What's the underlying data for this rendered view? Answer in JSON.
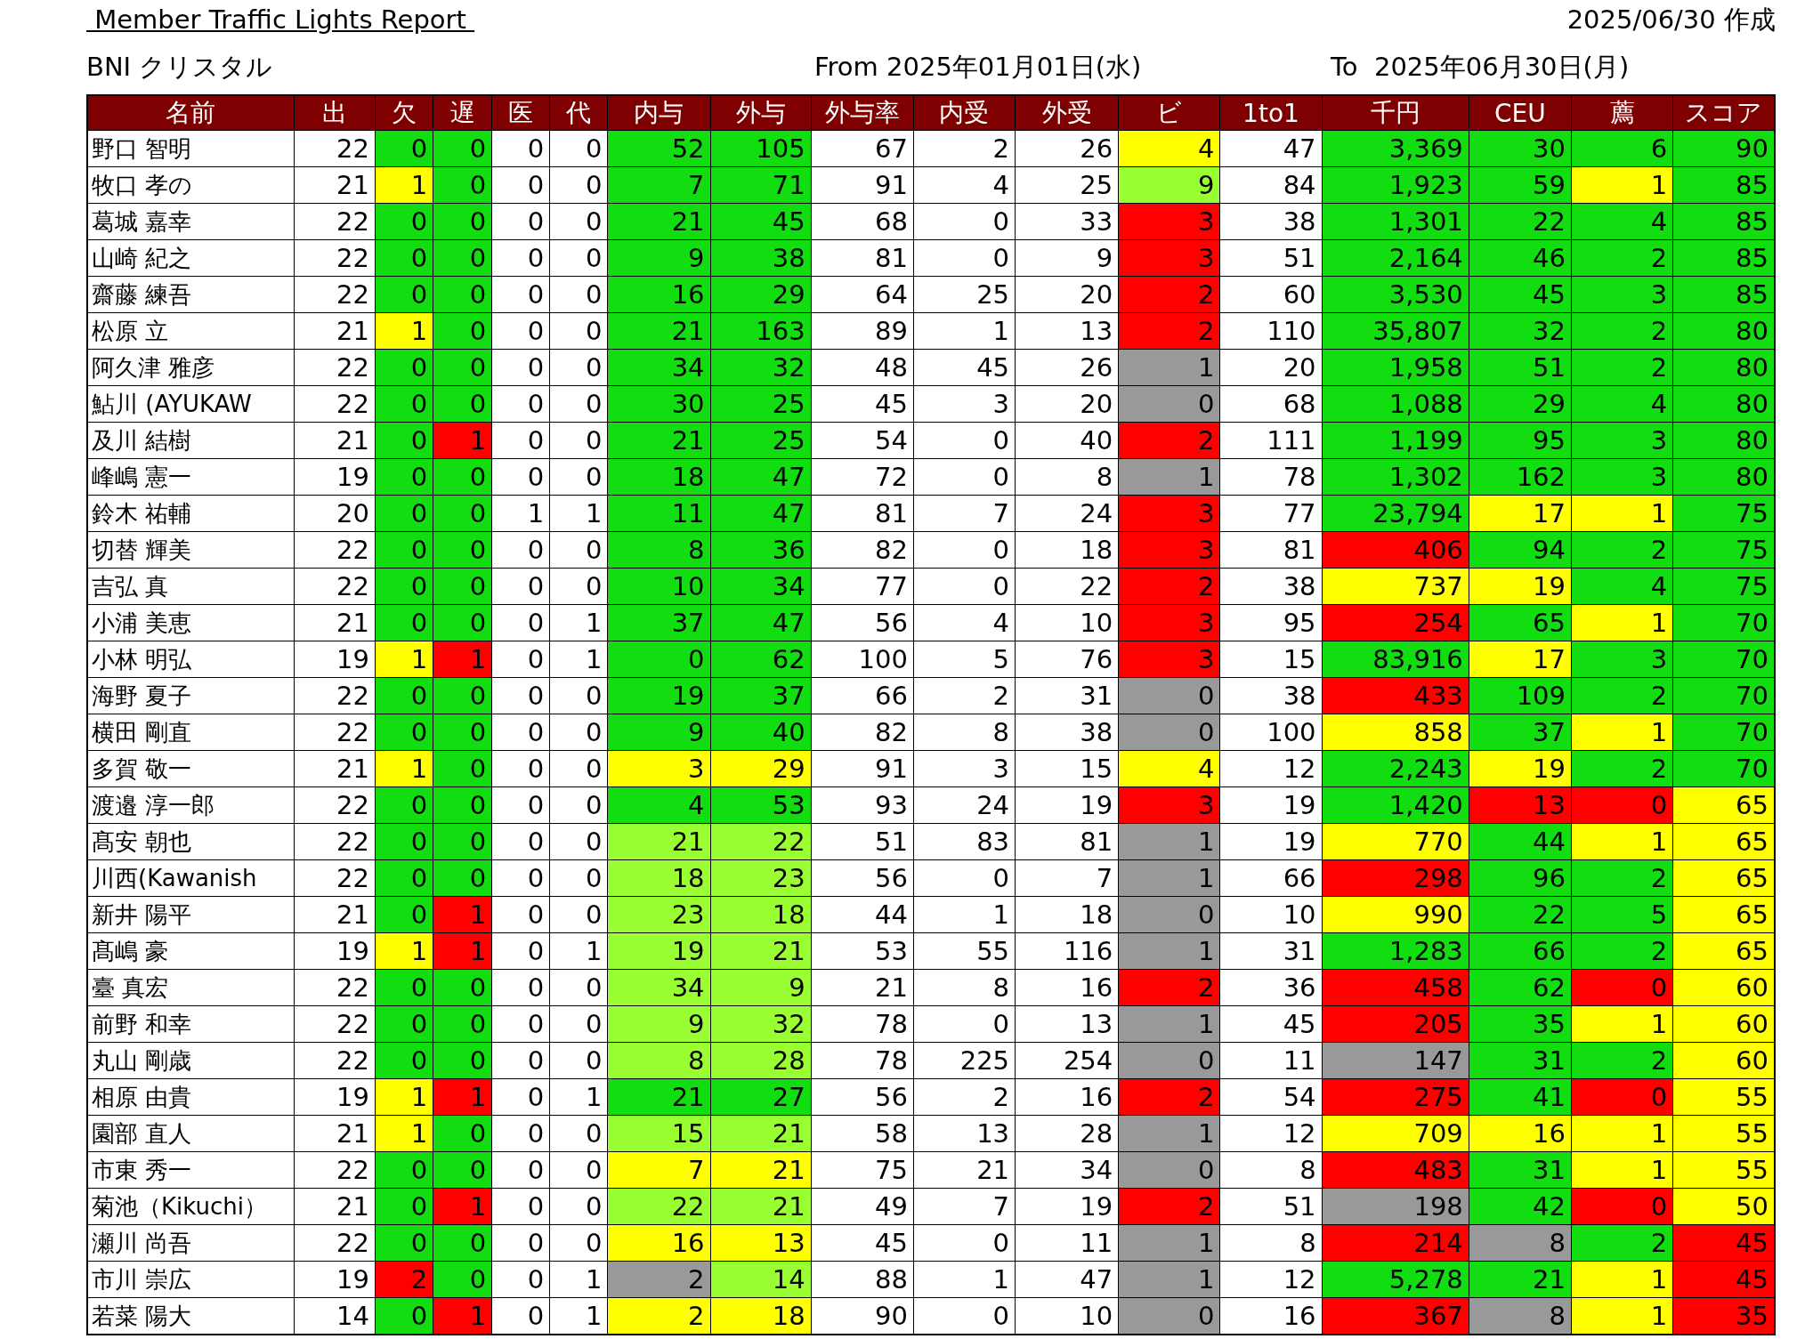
{
  "header": {
    "title": " Member Traffic Lights Report ",
    "created": "2025/06/30 作成",
    "group": "BNI クリスタル",
    "from": "From 2025年01月01日(水)",
    "to": "To  2025年06月30日(月)"
  },
  "table": {
    "columns": [
      "名前",
      "出",
      "欠",
      "遅",
      "医",
      "代",
      "内与",
      "外与",
      "外与率",
      "内受",
      "外受",
      "ビ",
      "1to1",
      "千円",
      "CEU",
      "薦",
      "スコア"
    ],
    "rows": [
      {
        "cells": [
          {
            "text": "野口 智明"
          },
          {
            "text": "22"
          },
          {
            "text": "0",
            "color": "#11dd11"
          },
          {
            "text": "0",
            "color": "#11dd11"
          },
          {
            "text": "0"
          },
          {
            "text": "0"
          },
          {
            "text": "52",
            "color": "#11dd11"
          },
          {
            "text": "105",
            "color": "#11dd11"
          },
          {
            "text": "67"
          },
          {
            "text": "2"
          },
          {
            "text": "26"
          },
          {
            "text": "4",
            "color": "#ffff00"
          },
          {
            "text": "47"
          },
          {
            "text": "3,369",
            "color": "#11dd11"
          },
          {
            "text": "30",
            "color": "#11dd11"
          },
          {
            "text": "6",
            "color": "#11dd11"
          },
          {
            "text": "90",
            "color": "#11dd11"
          }
        ]
      },
      {
        "cells": [
          {
            "text": "牧口 孝の"
          },
          {
            "text": "21"
          },
          {
            "text": "1",
            "color": "#ffff00"
          },
          {
            "text": "0",
            "color": "#11dd11"
          },
          {
            "text": "0"
          },
          {
            "text": "0"
          },
          {
            "text": "7",
            "color": "#11dd11"
          },
          {
            "text": "71",
            "color": "#11dd11"
          },
          {
            "text": "91"
          },
          {
            "text": "4"
          },
          {
            "text": "25"
          },
          {
            "text": "9",
            "color": "#99ff33"
          },
          {
            "text": "84"
          },
          {
            "text": "1,923",
            "color": "#11dd11"
          },
          {
            "text": "59",
            "color": "#11dd11"
          },
          {
            "text": "1",
            "color": "#ffff00"
          },
          {
            "text": "85",
            "color": "#11dd11"
          }
        ]
      },
      {
        "cells": [
          {
            "text": "葛城 嘉幸"
          },
          {
            "text": "22"
          },
          {
            "text": "0",
            "color": "#11dd11"
          },
          {
            "text": "0",
            "color": "#11dd11"
          },
          {
            "text": "0"
          },
          {
            "text": "0"
          },
          {
            "text": "21",
            "color": "#11dd11"
          },
          {
            "text": "45",
            "color": "#11dd11"
          },
          {
            "text": "68"
          },
          {
            "text": "0"
          },
          {
            "text": "33"
          },
          {
            "text": "3",
            "color": "#ff0000"
          },
          {
            "text": "38"
          },
          {
            "text": "1,301",
            "color": "#11dd11"
          },
          {
            "text": "22",
            "color": "#11dd11"
          },
          {
            "text": "4",
            "color": "#11dd11"
          },
          {
            "text": "85",
            "color": "#11dd11"
          }
        ]
      },
      {
        "cells": [
          {
            "text": "山崎 紀之"
          },
          {
            "text": "22"
          },
          {
            "text": "0",
            "color": "#11dd11"
          },
          {
            "text": "0",
            "color": "#11dd11"
          },
          {
            "text": "0"
          },
          {
            "text": "0"
          },
          {
            "text": "9",
            "color": "#11dd11"
          },
          {
            "text": "38",
            "color": "#11dd11"
          },
          {
            "text": "81"
          },
          {
            "text": "0"
          },
          {
            "text": "9"
          },
          {
            "text": "3",
            "color": "#ff0000"
          },
          {
            "text": "51"
          },
          {
            "text": "2,164",
            "color": "#11dd11"
          },
          {
            "text": "46",
            "color": "#11dd11"
          },
          {
            "text": "2",
            "color": "#11dd11"
          },
          {
            "text": "85",
            "color": "#11dd11"
          }
        ]
      },
      {
        "cells": [
          {
            "text": "齋藤 練吾"
          },
          {
            "text": "22"
          },
          {
            "text": "0",
            "color": "#11dd11"
          },
          {
            "text": "0",
            "color": "#11dd11"
          },
          {
            "text": "0"
          },
          {
            "text": "0"
          },
          {
            "text": "16",
            "color": "#11dd11"
          },
          {
            "text": "29",
            "color": "#11dd11"
          },
          {
            "text": "64"
          },
          {
            "text": "25"
          },
          {
            "text": "20"
          },
          {
            "text": "2",
            "color": "#ff0000"
          },
          {
            "text": "60"
          },
          {
            "text": "3,530",
            "color": "#11dd11"
          },
          {
            "text": "45",
            "color": "#11dd11"
          },
          {
            "text": "3",
            "color": "#11dd11"
          },
          {
            "text": "85",
            "color": "#11dd11"
          }
        ]
      },
      {
        "cells": [
          {
            "text": "松原 立"
          },
          {
            "text": "21"
          },
          {
            "text": "1",
            "color": "#ffff00"
          },
          {
            "text": "0",
            "color": "#11dd11"
          },
          {
            "text": "0"
          },
          {
            "text": "0"
          },
          {
            "text": "21",
            "color": "#11dd11"
          },
          {
            "text": "163",
            "color": "#11dd11"
          },
          {
            "text": "89"
          },
          {
            "text": "1"
          },
          {
            "text": "13"
          },
          {
            "text": "2",
            "color": "#ff0000"
          },
          {
            "text": "110"
          },
          {
            "text": "35,807",
            "color": "#11dd11"
          },
          {
            "text": "32",
            "color": "#11dd11"
          },
          {
            "text": "2",
            "color": "#11dd11"
          },
          {
            "text": "80",
            "color": "#11dd11"
          }
        ]
      },
      {
        "cells": [
          {
            "text": "阿久津 雅彦"
          },
          {
            "text": "22"
          },
          {
            "text": "0",
            "color": "#11dd11"
          },
          {
            "text": "0",
            "color": "#11dd11"
          },
          {
            "text": "0"
          },
          {
            "text": "0"
          },
          {
            "text": "34",
            "color": "#11dd11"
          },
          {
            "text": "32",
            "color": "#11dd11"
          },
          {
            "text": "48"
          },
          {
            "text": "45"
          },
          {
            "text": "26"
          },
          {
            "text": "1",
            "color": "#999999"
          },
          {
            "text": "20"
          },
          {
            "text": "1,958",
            "color": "#11dd11"
          },
          {
            "text": "51",
            "color": "#11dd11"
          },
          {
            "text": "2",
            "color": "#11dd11"
          },
          {
            "text": "80",
            "color": "#11dd11"
          }
        ]
      },
      {
        "cells": [
          {
            "text": "鮎川 (AYUKAW"
          },
          {
            "text": "22"
          },
          {
            "text": "0",
            "color": "#11dd11"
          },
          {
            "text": "0",
            "color": "#11dd11"
          },
          {
            "text": "0"
          },
          {
            "text": "0"
          },
          {
            "text": "30",
            "color": "#11dd11"
          },
          {
            "text": "25",
            "color": "#11dd11"
          },
          {
            "text": "45"
          },
          {
            "text": "3"
          },
          {
            "text": "20"
          },
          {
            "text": "0",
            "color": "#999999"
          },
          {
            "text": "68"
          },
          {
            "text": "1,088",
            "color": "#11dd11"
          },
          {
            "text": "29",
            "color": "#11dd11"
          },
          {
            "text": "4",
            "color": "#11dd11"
          },
          {
            "text": "80",
            "color": "#11dd11"
          }
        ]
      },
      {
        "cells": [
          {
            "text": "及川 結樹"
          },
          {
            "text": "21"
          },
          {
            "text": "0",
            "color": "#11dd11"
          },
          {
            "text": "1",
            "color": "#ff0000"
          },
          {
            "text": "0"
          },
          {
            "text": "0"
          },
          {
            "text": "21",
            "color": "#11dd11"
          },
          {
            "text": "25",
            "color": "#11dd11"
          },
          {
            "text": "54"
          },
          {
            "text": "0"
          },
          {
            "text": "40"
          },
          {
            "text": "2",
            "color": "#ff0000"
          },
          {
            "text": "111"
          },
          {
            "text": "1,199",
            "color": "#11dd11"
          },
          {
            "text": "95",
            "color": "#11dd11"
          },
          {
            "text": "3",
            "color": "#11dd11"
          },
          {
            "text": "80",
            "color": "#11dd11"
          }
        ]
      },
      {
        "cells": [
          {
            "text": "峰嶋 憲一"
          },
          {
            "text": "19"
          },
          {
            "text": "0",
            "color": "#11dd11"
          },
          {
            "text": "0",
            "color": "#11dd11"
          },
          {
            "text": "0"
          },
          {
            "text": "0"
          },
          {
            "text": "18",
            "color": "#11dd11"
          },
          {
            "text": "47",
            "color": "#11dd11"
          },
          {
            "text": "72"
          },
          {
            "text": "0"
          },
          {
            "text": "8"
          },
          {
            "text": "1",
            "color": "#999999"
          },
          {
            "text": "78"
          },
          {
            "text": "1,302",
            "color": "#11dd11"
          },
          {
            "text": "162",
            "color": "#11dd11"
          },
          {
            "text": "3",
            "color": "#11dd11"
          },
          {
            "text": "80",
            "color": "#11dd11"
          }
        ]
      },
      {
        "cells": [
          {
            "text": "鈴木 祐輔"
          },
          {
            "text": "20"
          },
          {
            "text": "0",
            "color": "#11dd11"
          },
          {
            "text": "0",
            "color": "#11dd11"
          },
          {
            "text": "1"
          },
          {
            "text": "1"
          },
          {
            "text": "11",
            "color": "#11dd11"
          },
          {
            "text": "47",
            "color": "#11dd11"
          },
          {
            "text": "81"
          },
          {
            "text": "7"
          },
          {
            "text": "24"
          },
          {
            "text": "3",
            "color": "#ff0000"
          },
          {
            "text": "77"
          },
          {
            "text": "23,794",
            "color": "#11dd11"
          },
          {
            "text": "17",
            "color": "#ffff00"
          },
          {
            "text": "1",
            "color": "#ffff00"
          },
          {
            "text": "75",
            "color": "#11dd11"
          }
        ]
      },
      {
        "cells": [
          {
            "text": "切替 輝美"
          },
          {
            "text": "22"
          },
          {
            "text": "0",
            "color": "#11dd11"
          },
          {
            "text": "0",
            "color": "#11dd11"
          },
          {
            "text": "0"
          },
          {
            "text": "0"
          },
          {
            "text": "8",
            "color": "#11dd11"
          },
          {
            "text": "36",
            "color": "#11dd11"
          },
          {
            "text": "82"
          },
          {
            "text": "0"
          },
          {
            "text": "18"
          },
          {
            "text": "3",
            "color": "#ff0000"
          },
          {
            "text": "81"
          },
          {
            "text": "406",
            "color": "#ff0000"
          },
          {
            "text": "94",
            "color": "#11dd11"
          },
          {
            "text": "2",
            "color": "#11dd11"
          },
          {
            "text": "75",
            "color": "#11dd11"
          }
        ]
      },
      {
        "cells": [
          {
            "text": "吉弘 真"
          },
          {
            "text": "22"
          },
          {
            "text": "0",
            "color": "#11dd11"
          },
          {
            "text": "0",
            "color": "#11dd11"
          },
          {
            "text": "0"
          },
          {
            "text": "0"
          },
          {
            "text": "10",
            "color": "#11dd11"
          },
          {
            "text": "34",
            "color": "#11dd11"
          },
          {
            "text": "77"
          },
          {
            "text": "0"
          },
          {
            "text": "22"
          },
          {
            "text": "2",
            "color": "#ff0000"
          },
          {
            "text": "38"
          },
          {
            "text": "737",
            "color": "#ffff00"
          },
          {
            "text": "19",
            "color": "#ffff00"
          },
          {
            "text": "4",
            "color": "#11dd11"
          },
          {
            "text": "75",
            "color": "#11dd11"
          }
        ]
      },
      {
        "cells": [
          {
            "text": "小浦 美恵"
          },
          {
            "text": "21"
          },
          {
            "text": "0",
            "color": "#11dd11"
          },
          {
            "text": "0",
            "color": "#11dd11"
          },
          {
            "text": "0"
          },
          {
            "text": "1"
          },
          {
            "text": "37",
            "color": "#11dd11"
          },
          {
            "text": "47",
            "color": "#11dd11"
          },
          {
            "text": "56"
          },
          {
            "text": "4"
          },
          {
            "text": "10"
          },
          {
            "text": "3",
            "color": "#ff0000"
          },
          {
            "text": "95"
          },
          {
            "text": "254",
            "color": "#ff0000"
          },
          {
            "text": "65",
            "color": "#11dd11"
          },
          {
            "text": "1",
            "color": "#ffff00"
          },
          {
            "text": "70",
            "color": "#11dd11"
          }
        ]
      },
      {
        "cells": [
          {
            "text": "小林 明弘"
          },
          {
            "text": "19"
          },
          {
            "text": "1",
            "color": "#ffff00"
          },
          {
            "text": "1",
            "color": "#ff0000"
          },
          {
            "text": "0"
          },
          {
            "text": "1"
          },
          {
            "text": "0",
            "color": "#11dd11"
          },
          {
            "text": "62",
            "color": "#11dd11"
          },
          {
            "text": "100"
          },
          {
            "text": "5"
          },
          {
            "text": "76"
          },
          {
            "text": "3",
            "color": "#ff0000"
          },
          {
            "text": "15"
          },
          {
            "text": "83,916",
            "color": "#11dd11"
          },
          {
            "text": "17",
            "color": "#ffff00"
          },
          {
            "text": "3",
            "color": "#11dd11"
          },
          {
            "text": "70",
            "color": "#11dd11"
          }
        ]
      },
      {
        "cells": [
          {
            "text": "海野 夏子"
          },
          {
            "text": "22"
          },
          {
            "text": "0",
            "color": "#11dd11"
          },
          {
            "text": "0",
            "color": "#11dd11"
          },
          {
            "text": "0"
          },
          {
            "text": "0"
          },
          {
            "text": "19",
            "color": "#11dd11"
          },
          {
            "text": "37",
            "color": "#11dd11"
          },
          {
            "text": "66"
          },
          {
            "text": "2"
          },
          {
            "text": "31"
          },
          {
            "text": "0",
            "color": "#999999"
          },
          {
            "text": "38"
          },
          {
            "text": "433",
            "color": "#ff0000"
          },
          {
            "text": "109",
            "color": "#11dd11"
          },
          {
            "text": "2",
            "color": "#11dd11"
          },
          {
            "text": "70",
            "color": "#11dd11"
          }
        ]
      },
      {
        "cells": [
          {
            "text": "横田 剛直"
          },
          {
            "text": "22"
          },
          {
            "text": "0",
            "color": "#11dd11"
          },
          {
            "text": "0",
            "color": "#11dd11"
          },
          {
            "text": "0"
          },
          {
            "text": "0"
          },
          {
            "text": "9",
            "color": "#11dd11"
          },
          {
            "text": "40",
            "color": "#11dd11"
          },
          {
            "text": "82"
          },
          {
            "text": "8"
          },
          {
            "text": "38"
          },
          {
            "text": "0",
            "color": "#999999"
          },
          {
            "text": "100"
          },
          {
            "text": "858",
            "color": "#ffff00"
          },
          {
            "text": "37",
            "color": "#11dd11"
          },
          {
            "text": "1",
            "color": "#ffff00"
          },
          {
            "text": "70",
            "color": "#11dd11"
          }
        ]
      },
      {
        "cells": [
          {
            "text": "多賀 敬一"
          },
          {
            "text": "21"
          },
          {
            "text": "1",
            "color": "#ffff00"
          },
          {
            "text": "0",
            "color": "#11dd11"
          },
          {
            "text": "0"
          },
          {
            "text": "0"
          },
          {
            "text": "3",
            "color": "#ffff00"
          },
          {
            "text": "29",
            "color": "#ffff00"
          },
          {
            "text": "91"
          },
          {
            "text": "3"
          },
          {
            "text": "15"
          },
          {
            "text": "4",
            "color": "#ffff00"
          },
          {
            "text": "12"
          },
          {
            "text": "2,243",
            "color": "#11dd11"
          },
          {
            "text": "19",
            "color": "#ffff00"
          },
          {
            "text": "2",
            "color": "#11dd11"
          },
          {
            "text": "70",
            "color": "#11dd11"
          }
        ]
      },
      {
        "cells": [
          {
            "text": "渡邉 淳一郎"
          },
          {
            "text": "22"
          },
          {
            "text": "0",
            "color": "#11dd11"
          },
          {
            "text": "0",
            "color": "#11dd11"
          },
          {
            "text": "0"
          },
          {
            "text": "0"
          },
          {
            "text": "4",
            "color": "#11dd11"
          },
          {
            "text": "53",
            "color": "#11dd11"
          },
          {
            "text": "93"
          },
          {
            "text": "24"
          },
          {
            "text": "19"
          },
          {
            "text": "3",
            "color": "#ff0000"
          },
          {
            "text": "19"
          },
          {
            "text": "1,420",
            "color": "#11dd11"
          },
          {
            "text": "13",
            "color": "#ff0000"
          },
          {
            "text": "0",
            "color": "#ff0000"
          },
          {
            "text": "65",
            "color": "#ffff00"
          }
        ]
      },
      {
        "cells": [
          {
            "text": "髙安 朝也"
          },
          {
            "text": "22"
          },
          {
            "text": "0",
            "color": "#11dd11"
          },
          {
            "text": "0",
            "color": "#11dd11"
          },
          {
            "text": "0"
          },
          {
            "text": "0"
          },
          {
            "text": "21",
            "color": "#99ff33"
          },
          {
            "text": "22",
            "color": "#99ff33"
          },
          {
            "text": "51"
          },
          {
            "text": "83"
          },
          {
            "text": "81"
          },
          {
            "text": "1",
            "color": "#999999"
          },
          {
            "text": "19"
          },
          {
            "text": "770",
            "color": "#ffff00"
          },
          {
            "text": "44",
            "color": "#11dd11"
          },
          {
            "text": "1",
            "color": "#ffff00"
          },
          {
            "text": "65",
            "color": "#ffff00"
          }
        ]
      },
      {
        "cells": [
          {
            "text": "川西(Kawanish"
          },
          {
            "text": "22"
          },
          {
            "text": "0",
            "color": "#11dd11"
          },
          {
            "text": "0",
            "color": "#11dd11"
          },
          {
            "text": "0"
          },
          {
            "text": "0"
          },
          {
            "text": "18",
            "color": "#99ff33"
          },
          {
            "text": "23",
            "color": "#99ff33"
          },
          {
            "text": "56"
          },
          {
            "text": "0"
          },
          {
            "text": "7"
          },
          {
            "text": "1",
            "color": "#999999"
          },
          {
            "text": "66"
          },
          {
            "text": "298",
            "color": "#ff0000"
          },
          {
            "text": "96",
            "color": "#11dd11"
          },
          {
            "text": "2",
            "color": "#11dd11"
          },
          {
            "text": "65",
            "color": "#ffff00"
          }
        ]
      },
      {
        "cells": [
          {
            "text": "新井 陽平"
          },
          {
            "text": "21"
          },
          {
            "text": "0",
            "color": "#11dd11"
          },
          {
            "text": "1",
            "color": "#ff0000"
          },
          {
            "text": "0"
          },
          {
            "text": "0"
          },
          {
            "text": "23",
            "color": "#99ff33"
          },
          {
            "text": "18",
            "color": "#99ff33"
          },
          {
            "text": "44"
          },
          {
            "text": "1"
          },
          {
            "text": "18"
          },
          {
            "text": "0",
            "color": "#999999"
          },
          {
            "text": "10"
          },
          {
            "text": "990",
            "color": "#ffff00"
          },
          {
            "text": "22",
            "color": "#11dd11"
          },
          {
            "text": "5",
            "color": "#11dd11"
          },
          {
            "text": "65",
            "color": "#ffff00"
          }
        ]
      },
      {
        "cells": [
          {
            "text": "髙嶋 豪"
          },
          {
            "text": "19"
          },
          {
            "text": "1",
            "color": "#ffff00"
          },
          {
            "text": "1",
            "color": "#ff0000"
          },
          {
            "text": "0"
          },
          {
            "text": "1"
          },
          {
            "text": "19",
            "color": "#99ff33"
          },
          {
            "text": "21",
            "color": "#99ff33"
          },
          {
            "text": "53"
          },
          {
            "text": "55"
          },
          {
            "text": "116"
          },
          {
            "text": "1",
            "color": "#999999"
          },
          {
            "text": "31"
          },
          {
            "text": "1,283",
            "color": "#11dd11"
          },
          {
            "text": "66",
            "color": "#11dd11"
          },
          {
            "text": "2",
            "color": "#11dd11"
          },
          {
            "text": "65",
            "color": "#ffff00"
          }
        ]
      },
      {
        "cells": [
          {
            "text": "臺 真宏"
          },
          {
            "text": "22"
          },
          {
            "text": "0",
            "color": "#11dd11"
          },
          {
            "text": "0",
            "color": "#11dd11"
          },
          {
            "text": "0"
          },
          {
            "text": "0"
          },
          {
            "text": "34",
            "color": "#99ff33"
          },
          {
            "text": "9",
            "color": "#99ff33"
          },
          {
            "text": "21"
          },
          {
            "text": "8"
          },
          {
            "text": "16"
          },
          {
            "text": "2",
            "color": "#ff0000"
          },
          {
            "text": "36"
          },
          {
            "text": "458",
            "color": "#ff0000"
          },
          {
            "text": "62",
            "color": "#11dd11"
          },
          {
            "text": "0",
            "color": "#ff0000"
          },
          {
            "text": "60",
            "color": "#ffff00"
          }
        ]
      },
      {
        "cells": [
          {
            "text": "前野 和幸"
          },
          {
            "text": "22"
          },
          {
            "text": "0",
            "color": "#11dd11"
          },
          {
            "text": "0",
            "color": "#11dd11"
          },
          {
            "text": "0"
          },
          {
            "text": "0"
          },
          {
            "text": "9",
            "color": "#99ff33"
          },
          {
            "text": "32",
            "color": "#99ff33"
          },
          {
            "text": "78"
          },
          {
            "text": "0"
          },
          {
            "text": "13"
          },
          {
            "text": "1",
            "color": "#999999"
          },
          {
            "text": "45"
          },
          {
            "text": "205",
            "color": "#ff0000"
          },
          {
            "text": "35",
            "color": "#11dd11"
          },
          {
            "text": "1",
            "color": "#ffff00"
          },
          {
            "text": "60",
            "color": "#ffff00"
          }
        ]
      },
      {
        "cells": [
          {
            "text": "丸山 剛歳"
          },
          {
            "text": "22"
          },
          {
            "text": "0",
            "color": "#11dd11"
          },
          {
            "text": "0",
            "color": "#11dd11"
          },
          {
            "text": "0"
          },
          {
            "text": "0"
          },
          {
            "text": "8",
            "color": "#99ff33"
          },
          {
            "text": "28",
            "color": "#99ff33"
          },
          {
            "text": "78"
          },
          {
            "text": "225"
          },
          {
            "text": "254"
          },
          {
            "text": "0",
            "color": "#999999"
          },
          {
            "text": "11"
          },
          {
            "text": "147",
            "color": "#999999"
          },
          {
            "text": "31",
            "color": "#11dd11"
          },
          {
            "text": "2",
            "color": "#11dd11"
          },
          {
            "text": "60",
            "color": "#ffff00"
          }
        ]
      },
      {
        "cells": [
          {
            "text": "相原 由貴"
          },
          {
            "text": "19"
          },
          {
            "text": "1",
            "color": "#ffff00"
          },
          {
            "text": "1",
            "color": "#ff0000"
          },
          {
            "text": "0"
          },
          {
            "text": "1"
          },
          {
            "text": "21",
            "color": "#11dd11"
          },
          {
            "text": "27",
            "color": "#11dd11"
          },
          {
            "text": "56"
          },
          {
            "text": "2"
          },
          {
            "text": "16"
          },
          {
            "text": "2",
            "color": "#ff0000"
          },
          {
            "text": "54"
          },
          {
            "text": "275",
            "color": "#ff0000"
          },
          {
            "text": "41",
            "color": "#11dd11"
          },
          {
            "text": "0",
            "color": "#ff0000"
          },
          {
            "text": "55",
            "color": "#ffff00"
          }
        ]
      },
      {
        "cells": [
          {
            "text": "園部 直人"
          },
          {
            "text": "21"
          },
          {
            "text": "1",
            "color": "#ffff00"
          },
          {
            "text": "0",
            "color": "#11dd11"
          },
          {
            "text": "0"
          },
          {
            "text": "0"
          },
          {
            "text": "15",
            "color": "#99ff33"
          },
          {
            "text": "21",
            "color": "#99ff33"
          },
          {
            "text": "58"
          },
          {
            "text": "13"
          },
          {
            "text": "28"
          },
          {
            "text": "1",
            "color": "#999999"
          },
          {
            "text": "12"
          },
          {
            "text": "709",
            "color": "#ffff00"
          },
          {
            "text": "16",
            "color": "#ffff00"
          },
          {
            "text": "1",
            "color": "#ffff00"
          },
          {
            "text": "55",
            "color": "#ffff00"
          }
        ]
      },
      {
        "cells": [
          {
            "text": "市東 秀一"
          },
          {
            "text": "22"
          },
          {
            "text": "0",
            "color": "#11dd11"
          },
          {
            "text": "0",
            "color": "#11dd11"
          },
          {
            "text": "0"
          },
          {
            "text": "0"
          },
          {
            "text": "7",
            "color": "#ffff00"
          },
          {
            "text": "21",
            "color": "#ffff00"
          },
          {
            "text": "75"
          },
          {
            "text": "21"
          },
          {
            "text": "34"
          },
          {
            "text": "0",
            "color": "#999999"
          },
          {
            "text": "8"
          },
          {
            "text": "483",
            "color": "#ff0000"
          },
          {
            "text": "31",
            "color": "#11dd11"
          },
          {
            "text": "1",
            "color": "#ffff00"
          },
          {
            "text": "55",
            "color": "#ffff00"
          }
        ]
      },
      {
        "cells": [
          {
            "text": "菊池（Kikuchi）"
          },
          {
            "text": "21"
          },
          {
            "text": "0",
            "color": "#11dd11"
          },
          {
            "text": "1",
            "color": "#ff0000"
          },
          {
            "text": "0"
          },
          {
            "text": "0"
          },
          {
            "text": "22",
            "color": "#99ff33"
          },
          {
            "text": "21",
            "color": "#99ff33"
          },
          {
            "text": "49"
          },
          {
            "text": "7"
          },
          {
            "text": "19"
          },
          {
            "text": "2",
            "color": "#ff0000"
          },
          {
            "text": "51"
          },
          {
            "text": "198",
            "color": "#999999"
          },
          {
            "text": "42",
            "color": "#11dd11"
          },
          {
            "text": "0",
            "color": "#ff0000"
          },
          {
            "text": "50",
            "color": "#ffff00"
          }
        ]
      },
      {
        "cells": [
          {
            "text": "瀬川 尚吾"
          },
          {
            "text": "22"
          },
          {
            "text": "0",
            "color": "#11dd11"
          },
          {
            "text": "0",
            "color": "#11dd11"
          },
          {
            "text": "0"
          },
          {
            "text": "0"
          },
          {
            "text": "16",
            "color": "#ffff00"
          },
          {
            "text": "13",
            "color": "#ffff00"
          },
          {
            "text": "45"
          },
          {
            "text": "0"
          },
          {
            "text": "11"
          },
          {
            "text": "1",
            "color": "#999999"
          },
          {
            "text": "8"
          },
          {
            "text": "214",
            "color": "#ff0000"
          },
          {
            "text": "8",
            "color": "#999999"
          },
          {
            "text": "2",
            "color": "#11dd11"
          },
          {
            "text": "45",
            "color": "#ff0000"
          }
        ]
      },
      {
        "cells": [
          {
            "text": "市川 崇広"
          },
          {
            "text": "19"
          },
          {
            "text": "2",
            "color": "#ff0000"
          },
          {
            "text": "0",
            "color": "#11dd11"
          },
          {
            "text": "0"
          },
          {
            "text": "1"
          },
          {
            "text": "2",
            "color": "#999999"
          },
          {
            "text": "14",
            "color": "#99ff33"
          },
          {
            "text": "88"
          },
          {
            "text": "1"
          },
          {
            "text": "47"
          },
          {
            "text": "1",
            "color": "#999999"
          },
          {
            "text": "12"
          },
          {
            "text": "5,278",
            "color": "#11dd11"
          },
          {
            "text": "21",
            "color": "#11dd11"
          },
          {
            "text": "1",
            "color": "#ffff00"
          },
          {
            "text": "45",
            "color": "#ff0000"
          }
        ]
      },
      {
        "cells": [
          {
            "text": "若菜 陽大"
          },
          {
            "text": "14"
          },
          {
            "text": "0",
            "color": "#11dd11"
          },
          {
            "text": "1",
            "color": "#ff0000"
          },
          {
            "text": "0"
          },
          {
            "text": "1"
          },
          {
            "text": "2",
            "color": "#ffff00"
          },
          {
            "text": "18",
            "color": "#ffff00"
          },
          {
            "text": "90"
          },
          {
            "text": "0"
          },
          {
            "text": "10"
          },
          {
            "text": "0",
            "color": "#999999"
          },
          {
            "text": "16"
          },
          {
            "text": "367",
            "color": "#ff0000"
          },
          {
            "text": "8",
            "color": "#999999"
          },
          {
            "text": "1",
            "color": "#ffff00"
          },
          {
            "text": "35",
            "color": "#ff0000"
          }
        ]
      }
    ]
  }
}
